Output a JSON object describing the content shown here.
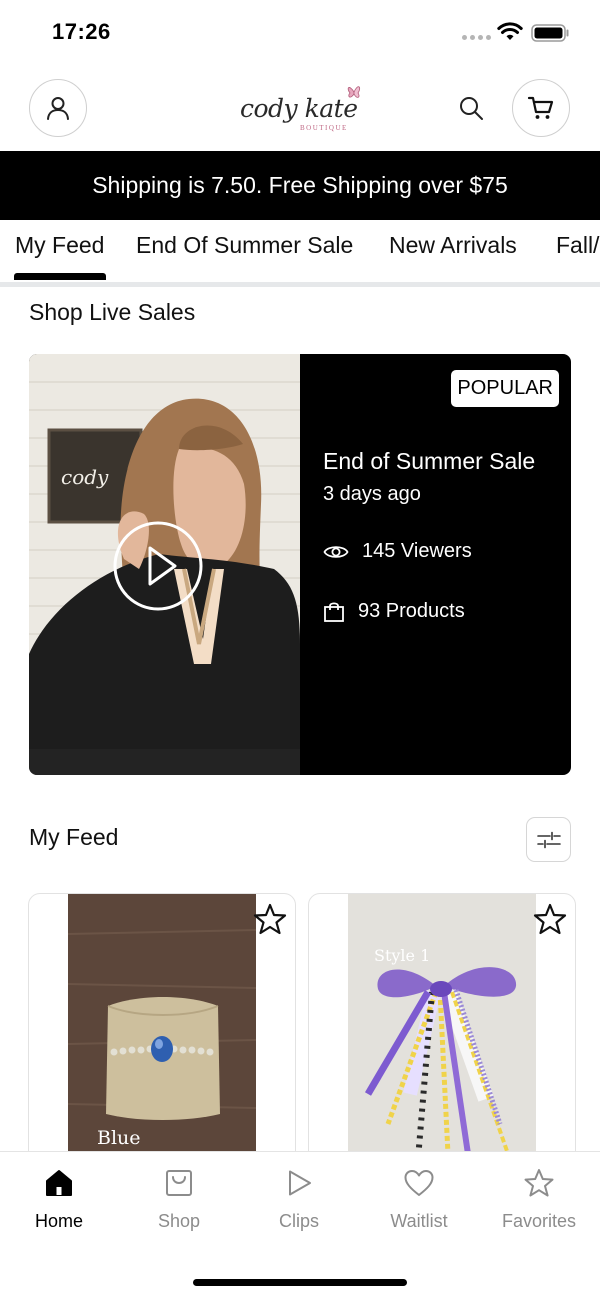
{
  "status_bar": {
    "time": "17:26"
  },
  "header": {
    "logo_script": "cody kate",
    "logo_sub": "BOUTIQUE",
    "icons": [
      "user-icon",
      "search-icon",
      "cart-icon"
    ]
  },
  "banner": {
    "text": "Shipping is 7.50. Free Shipping over $75"
  },
  "tabs": [
    {
      "label": "My Feed",
      "active": true
    },
    {
      "label": "End Of Summer Sale",
      "active": false
    },
    {
      "label": "New Arrivals",
      "active": false
    },
    {
      "label": "Fall/",
      "active": false
    }
  ],
  "live_sales": {
    "section_title": "Shop Live Sales",
    "card": {
      "badge": "POPULAR",
      "title": "End of Summer Sale",
      "time": "3 days ago",
      "viewers": "145 Viewers",
      "products": "93 Products",
      "sign_text": "cody"
    }
  },
  "feed": {
    "section_title": "My Feed",
    "products": [
      {
        "caption": "Blue"
      },
      {
        "caption": "Style 1"
      }
    ]
  },
  "bottom_nav": [
    {
      "label": "Home",
      "icon": "home-icon",
      "active": true
    },
    {
      "label": "Shop",
      "icon": "shopping-bag-icon",
      "active": false
    },
    {
      "label": "Clips",
      "icon": "play-icon",
      "active": false
    },
    {
      "label": "Waitlist",
      "icon": "heart-icon",
      "active": false
    },
    {
      "label": "Favorites",
      "icon": "star-icon",
      "active": false
    }
  ],
  "colors": {
    "accent": "#000000",
    "banner_bg": "#000000",
    "inactive": "#8c8c8c",
    "logo_pink": "#c06a86"
  }
}
